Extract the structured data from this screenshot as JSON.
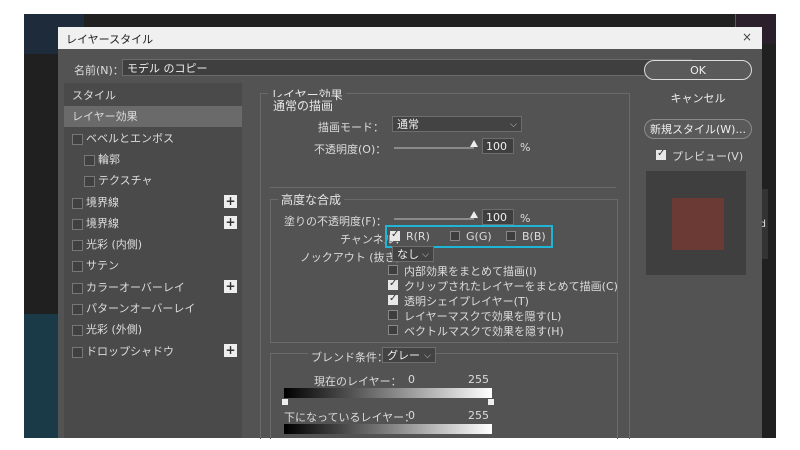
{
  "dialog": {
    "title": "レイヤースタイル",
    "close": "×"
  },
  "name": {
    "label": "名前(N)：",
    "value": "モデル のコピー"
  },
  "sidebar": {
    "items": [
      {
        "label": "スタイル",
        "checkbox": false,
        "plus": false,
        "active": false,
        "indent": 0
      },
      {
        "label": "レイヤー効果",
        "checkbox": false,
        "plus": false,
        "active": true,
        "indent": 0
      },
      {
        "label": "ベベルとエンボス",
        "checkbox": true,
        "plus": false,
        "active": false,
        "indent": 0
      },
      {
        "label": "輪郭",
        "checkbox": true,
        "plus": false,
        "active": false,
        "indent": 1
      },
      {
        "label": "テクスチャ",
        "checkbox": true,
        "plus": false,
        "active": false,
        "indent": 1
      },
      {
        "label": "境界線",
        "checkbox": true,
        "plus": true,
        "active": false,
        "indent": 0
      },
      {
        "label": "境界線",
        "checkbox": true,
        "plus": true,
        "active": false,
        "indent": 0
      },
      {
        "label": "光彩 (内側)",
        "checkbox": true,
        "plus": false,
        "active": false,
        "indent": 0
      },
      {
        "label": "サテン",
        "checkbox": true,
        "plus": false,
        "active": false,
        "indent": 0
      },
      {
        "label": "カラーオーバーレイ",
        "checkbox": true,
        "plus": true,
        "active": false,
        "indent": 0
      },
      {
        "label": "パターンオーバーレイ",
        "checkbox": true,
        "plus": false,
        "active": false,
        "indent": 0
      },
      {
        "label": "光彩 (外側)",
        "checkbox": true,
        "plus": false,
        "active": false,
        "indent": 0
      },
      {
        "label": "ドロップシャドウ",
        "checkbox": true,
        "plus": true,
        "active": false,
        "indent": 0
      }
    ],
    "plus_glyph": "+"
  },
  "effects": {
    "title": "レイヤー効果",
    "normal": {
      "title": "通常の描画",
      "blend_label": "描画モード：",
      "blend_value": "通常",
      "opacity_label": "不透明度(O)：",
      "opacity_value": "100",
      "opacity_level": 100,
      "unit": "%"
    },
    "advanced": {
      "title": "高度な合成",
      "fill_label": "塗りの不透明度(F)：",
      "fill_value": "100",
      "fill_level": 100,
      "unit": "%",
      "channel_label": "チャンネル：",
      "channels": [
        {
          "label": "R(R)",
          "checked": true
        },
        {
          "label": "G(G)",
          "checked": false
        },
        {
          "label": "B(B)",
          "checked": false
        }
      ],
      "knockout_label": "ノックアウト (抜き)：",
      "knockout_value": "なし",
      "options": [
        {
          "label": "内部効果をまとめて描画(I)",
          "checked": false
        },
        {
          "label": "クリップされたレイヤーをまとめて描画(C)",
          "checked": true
        },
        {
          "label": "透明シェイプレイヤー(T)",
          "checked": true
        },
        {
          "label": "レイヤーマスクで効果を隠す(L)",
          "checked": false
        },
        {
          "label": "ベクトルマスクで効果を隠す(H)",
          "checked": false
        }
      ]
    },
    "blendif": {
      "label": "ブレンド条件：",
      "value": "グレー",
      "current_label": "現在のレイヤー：",
      "current_min": "0",
      "current_max": "255",
      "under_label": "下になっているレイヤー：",
      "under_min": "0",
      "under_max": "255"
    }
  },
  "buttons": {
    "ok": "OK",
    "cancel": "キャンセル",
    "new_style": "新規スタイル(W)...",
    "preview_label": "プレビュー(V)",
    "preview_checked": true
  },
  "background": {
    "side_label": "Sd"
  },
  "colors": {
    "highlight": "#1fb5d6",
    "dialog": "#535353",
    "preview_swatch": "#6b3a34"
  },
  "icons": {
    "dropdown": "chevron-down-icon",
    "close": "close-icon",
    "add": "plus-icon",
    "cursor": "pointer-cursor-icon"
  }
}
